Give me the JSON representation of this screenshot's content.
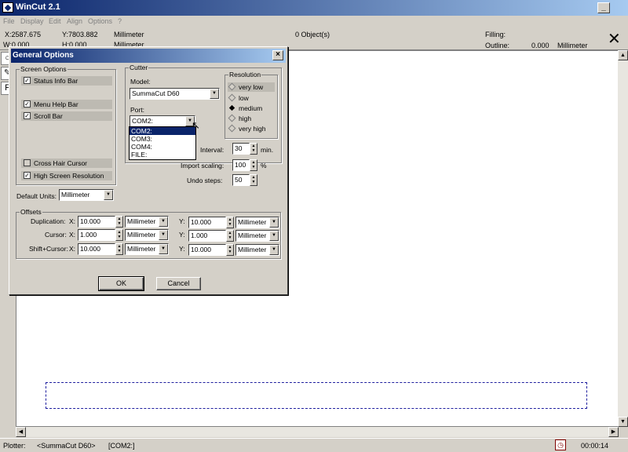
{
  "app": {
    "title": "WinCut 2.1"
  },
  "menu": [
    "File",
    "Display",
    "Edit",
    "Align",
    "Options",
    "?"
  ],
  "info": {
    "x": "X:2587.675",
    "y": "Y:7803.882",
    "unit1": "Millimeter",
    "w": "W:0.000",
    "h": "H:0.000",
    "unit2": "Millimeter",
    "objects": "0 Object(s)",
    "filling": "Filling:",
    "outline": "Outline:",
    "outline_val": "0.000",
    "outline_unit": "Millimeter"
  },
  "status": {
    "plotter_label": "Plotter:",
    "plotter": "<SummaCut D60>",
    "port": "[COM2:]",
    "time": "00:00:14"
  },
  "dialog": {
    "title": "General Options",
    "screen_options": {
      "label": "Screen Options",
      "items": [
        {
          "label": "Status Info Bar",
          "checked": true
        },
        {
          "label": "Menu Help Bar",
          "checked": true
        },
        {
          "label": "Scroll Bar",
          "checked": true
        },
        {
          "label": "Cross Hair Cursor",
          "checked": false
        },
        {
          "label": "High Screen Resolution",
          "checked": true
        }
      ]
    },
    "default_units_label": "Default Units:",
    "default_units": "Millimeter",
    "cutter": {
      "label": "Cutter",
      "model_label": "Model:",
      "model": "SummaCut D60",
      "port_label": "Port:",
      "port": "COM2:",
      "port_options": [
        "COM2:",
        "COM3:",
        "COM4:",
        "FILE:"
      ]
    },
    "resolution": {
      "label": "Resolution",
      "options": [
        "very low",
        "low",
        "medium",
        "high",
        "very high"
      ],
      "selected": "medium"
    },
    "interval_label": "Interval:",
    "interval": "30",
    "interval_unit": "min.",
    "import_label": "Import scaling:",
    "import": "100",
    "import_unit": "%",
    "undo_label": "Undo steps:",
    "undo": "50",
    "offsets": {
      "label": "Offsets",
      "rows": [
        {
          "label": "Duplication:",
          "xl": "X:",
          "x": "10.000",
          "xu": "Millimeter",
          "yl": "Y:",
          "y": "10.000",
          "yu": "Millimeter"
        },
        {
          "label": "Cursor:",
          "xl": "X:",
          "x": "1.000",
          "xu": "Millimeter",
          "yl": "Y:",
          "y": "1.000",
          "yu": "Millimeter"
        },
        {
          "label": "Shift+Cursor:",
          "xl": "X:",
          "x": "10.000",
          "xu": "Millimeter",
          "yl": "Y:",
          "y": "10.000",
          "yu": "Millimeter"
        }
      ]
    },
    "ok": "OK",
    "cancel": "Cancel"
  }
}
